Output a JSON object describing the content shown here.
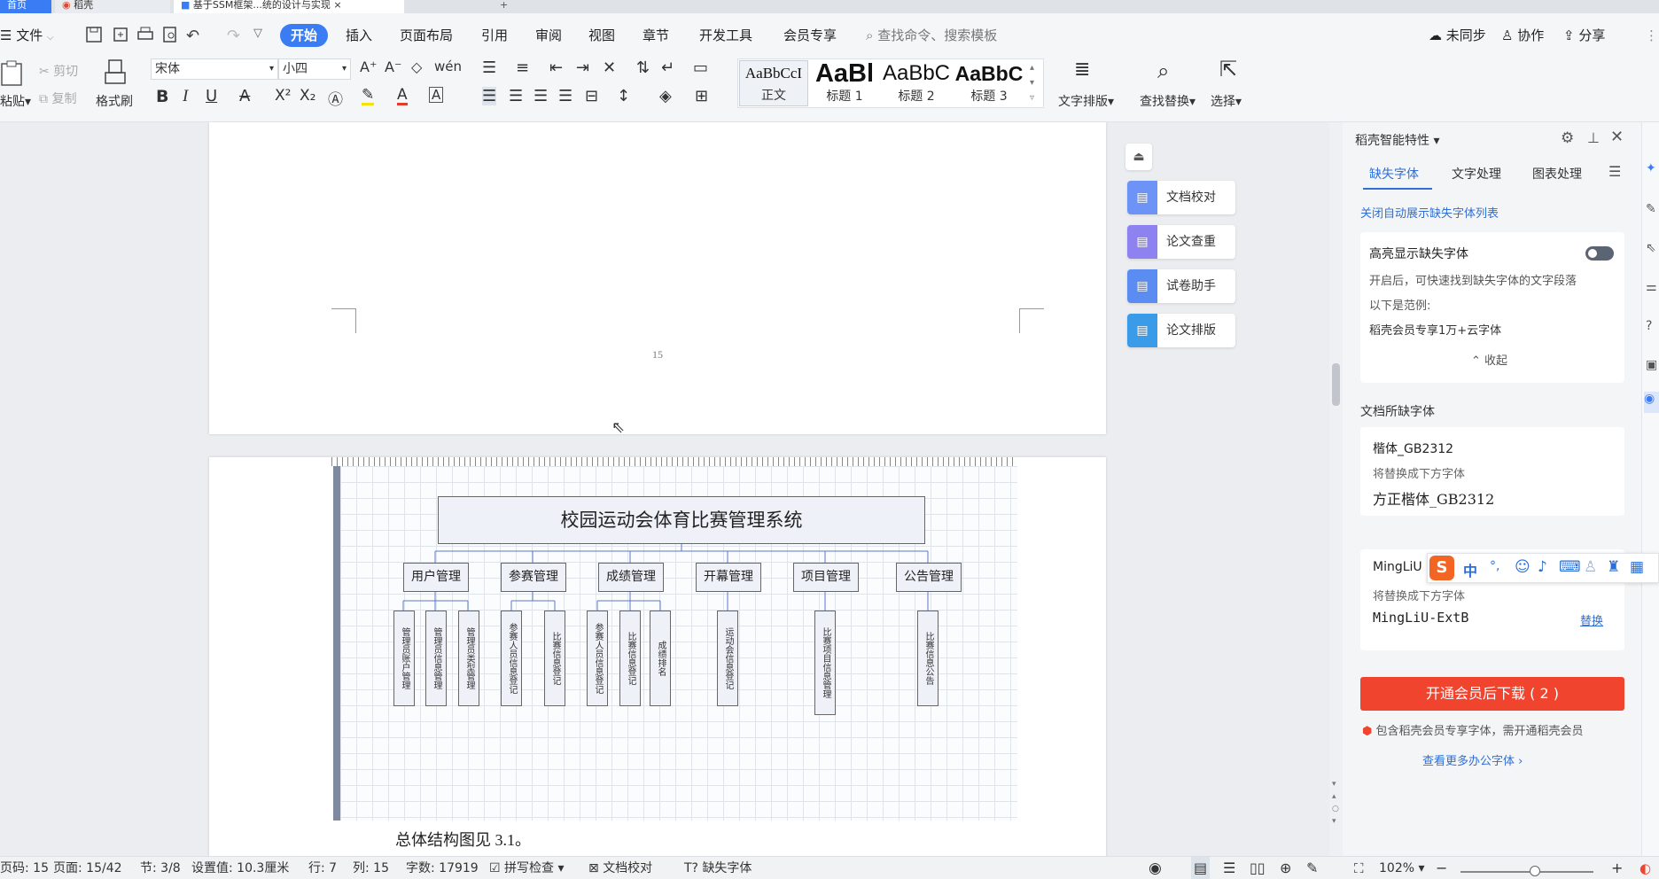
{
  "tabs": {
    "home": "首页",
    "daoke": "稻壳",
    "doc": "基于SSM框架...统的设计与实现",
    "add": "+"
  },
  "menu": {
    "file": "文件",
    "items": [
      "开始",
      "插入",
      "页面布局",
      "引用",
      "审阅",
      "视图",
      "章节",
      "开发工具",
      "会员专享"
    ],
    "search_placeholder": "查找命令、搜索模板",
    "sync": "未同步",
    "collab": "协作",
    "share": "分享"
  },
  "ribbon": {
    "paste": "粘贴",
    "cut": "剪切",
    "copy": "复制",
    "format_painter": "格式刷",
    "font": "宋体",
    "size": "小四",
    "styles": [
      {
        "preview": "AaBbCcI",
        "name": "正文"
      },
      {
        "preview": "AaBl",
        "name": "标题 1"
      },
      {
        "preview": "AaBbC",
        "name": "标题 2"
      },
      {
        "preview": "AaBbC",
        "name": "标题 3"
      }
    ],
    "layout": "文字排版",
    "find": "查找替换",
    "select": "选择"
  },
  "document": {
    "page_number": "15",
    "chart_title": "校园运动会体育比赛管理系统",
    "modules": [
      "用户管理",
      "参赛管理",
      "成绩管理",
      "开幕管理",
      "项目管理",
      "公告管理"
    ],
    "subs": [
      "管理员账户管理",
      "管理员信息管理",
      "管理员类型管理",
      "参赛人员信息登记",
      "比赛信息登记",
      "参赛人员信息登记",
      "比赛信息登记",
      "成绩排名",
      "运动会信息登记",
      "比赛项目信息管理",
      "比赛信息公告"
    ],
    "caption": "总体结构图见 3.1。"
  },
  "float_tools": [
    "文档校对",
    "论文查重",
    "试卷助手",
    "论文排版"
  ],
  "panel": {
    "title": "稻壳智能特性",
    "tabs": [
      "缺失字体",
      "文字处理",
      "图表处理"
    ],
    "close_auto": "关闭自动展示缺失字体列表",
    "highlight_title": "高亮显示缺失字体",
    "highlight_desc": "开启后，可快速找到缺失字体的文字段落",
    "example_label": "以下是范例:",
    "example_text": "稻壳会员专享1万+云字体",
    "collapse": "收起",
    "missing_title": "文档所缺字体",
    "font1_name": "楷体_GB2312",
    "replace_with": "将替换成下方字体",
    "font1_replacement": "方正楷体_GB2312",
    "font2_name": "MingLiU",
    "font2_replacement": "MingLiU-ExtB",
    "replace_btn": "替换",
    "download_btn": "开通会员后下载 ( 2 )",
    "member_note": "包含稻壳会员专享字体，需开通稻壳会员",
    "more_fonts": "查看更多办公字体"
  },
  "ime": {
    "items": [
      "中",
      "°,"
    ]
  },
  "status": {
    "page_code": "页码: 15",
    "page": "页面: 15/42",
    "section": "节: 3/8",
    "setting": "设置值: 10.3厘米",
    "row": "行: 7",
    "col": "列: 15",
    "words": "字数: 17919",
    "spell": "拼写检查",
    "proof": "文档校对",
    "missing_font": "缺失字体",
    "zoom": "102%"
  },
  "colors": {
    "accent": "#3a7cf4",
    "download": "#f0442f",
    "panel_link": "#2f6fd6"
  }
}
